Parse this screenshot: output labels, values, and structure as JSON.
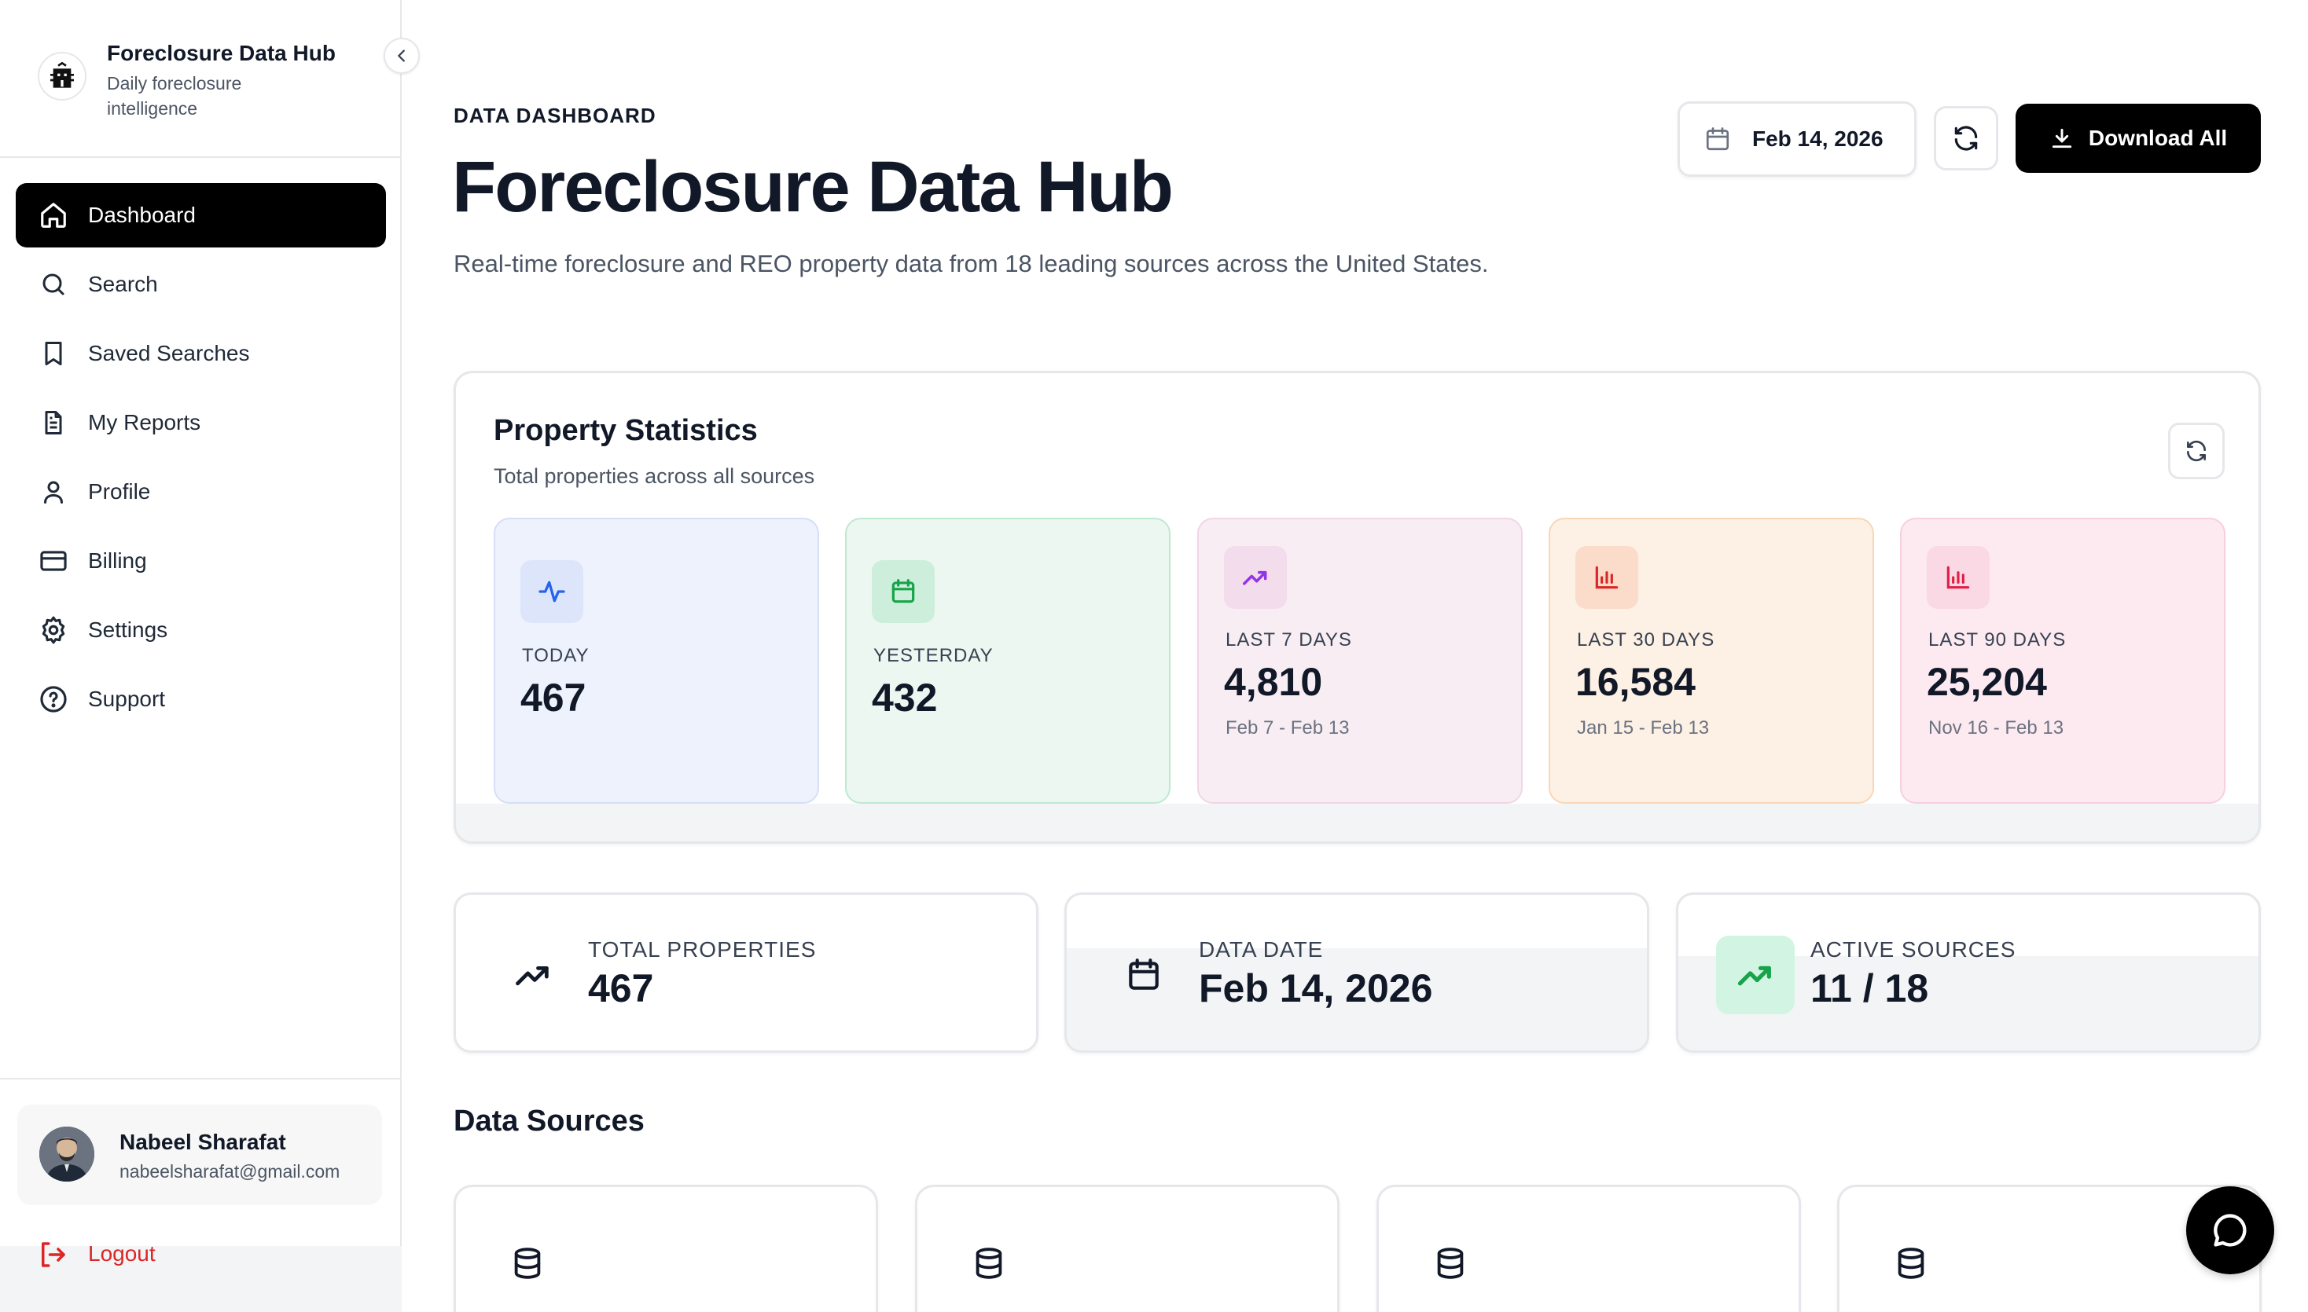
{
  "sidebar": {
    "brand_title": "Foreclosure Data Hub",
    "brand_subtitle": "Daily foreclosure intelligence",
    "items": [
      {
        "label": "Dashboard",
        "icon": "home-icon",
        "active": true
      },
      {
        "label": "Search",
        "icon": "search-icon"
      },
      {
        "label": "Saved Searches",
        "icon": "bookmark-icon"
      },
      {
        "label": "My Reports",
        "icon": "file-text-icon"
      },
      {
        "label": "Profile",
        "icon": "user-icon"
      },
      {
        "label": "Billing",
        "icon": "credit-card-icon"
      },
      {
        "label": "Settings",
        "icon": "gear-icon"
      },
      {
        "label": "Support",
        "icon": "help-circle-icon"
      }
    ],
    "user": {
      "name": "Nabeel Sharafat",
      "email": "nabeelsharafat@gmail.com"
    },
    "logout_label": "Logout"
  },
  "header": {
    "eyebrow": "DATA DASHBOARD",
    "title": "Foreclosure Data Hub",
    "description": "Real-time foreclosure and REO property data from 18 leading sources across the United States.",
    "date_label": "Feb 14, 2026",
    "download_label": "Download All"
  },
  "stats": {
    "title": "Property Statistics",
    "subtitle": "Total properties across all sources",
    "tiles": [
      {
        "label": "TODAY",
        "value": "467",
        "range": "",
        "icon": "activity-icon"
      },
      {
        "label": "YESTERDAY",
        "value": "432",
        "range": "",
        "icon": "calendar-icon"
      },
      {
        "label": "LAST 7 DAYS",
        "value": "4,810",
        "range": "Feb 7 - Feb 13",
        "icon": "trending-up-icon"
      },
      {
        "label": "LAST 30 DAYS",
        "value": "16,584",
        "range": "Jan 15 - Feb 13",
        "icon": "bar-chart-icon"
      },
      {
        "label": "LAST 90 DAYS",
        "value": "25,204",
        "range": "Nov 16 - Feb 13",
        "icon": "bar-chart-icon"
      }
    ]
  },
  "info": [
    {
      "label": "TOTAL PROPERTIES",
      "value": "467",
      "icon": "trending-up-icon"
    },
    {
      "label": "DATA DATE",
      "value": "Feb 14, 2026",
      "icon": "calendar-icon"
    },
    {
      "label": "ACTIVE SOURCES",
      "value": "11 / 18",
      "icon": "trending-up-icon"
    }
  ],
  "sources": {
    "title": "Data Sources",
    "icon": "database-icon"
  },
  "colors": {
    "accent": "#000000",
    "logout": "#dc2626",
    "tile_today_bg": "#eef2fd",
    "tile_yesterday_bg": "#ecf7f1",
    "tile_7d_bg": "#f9edf4",
    "tile_30d_bg": "#fdf0e4",
    "tile_90d_bg": "#fdeaf1"
  }
}
